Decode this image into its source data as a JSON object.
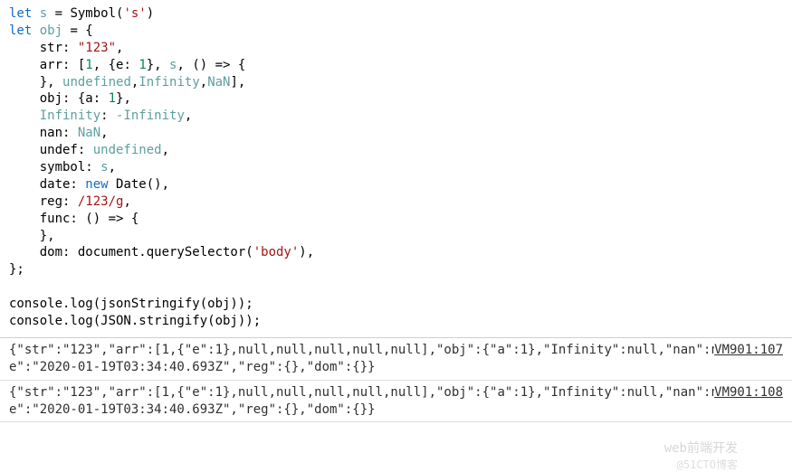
{
  "code": {
    "line0_let": "let ",
    "line0_s": "s",
    "line0_eq": " = Symbol(",
    "line0_str": "'s'",
    "line0_end": ")",
    "line1_let": "let ",
    "line1_obj": "obj",
    "line1_eq": " = {",
    "line2_prop": "    str: ",
    "line2_val": "\"123\"",
    "line2_end": ",",
    "line3_prop": "    arr: [",
    "line3_n1": "1",
    "line3_mid1": ", {e: ",
    "line3_n2": "1",
    "line3_mid2": "}, ",
    "line3_s": "s",
    "line3_mid3": ", () => {",
    "line4_close": "    }, ",
    "line4_undef": "undefined",
    "line4_sep1": ",",
    "line4_inf": "Infinity",
    "line4_sep2": ",",
    "line4_nan": "NaN",
    "line4_end": "],",
    "line5_prop": "    obj: {a: ",
    "line5_n": "1",
    "line5_end": "},",
    "line6_prop": "    ",
    "line6_inf": "Infinity",
    "line6_mid": ": ",
    "line6_neg": "-Infinity",
    "line6_end": ",",
    "line7_prop": "    nan: ",
    "line7_nan": "NaN",
    "line7_end": ",",
    "line8_prop": "    undef: ",
    "line8_undef": "undefined",
    "line8_end": ",",
    "line9_prop": "    symbol: ",
    "line9_s": "s",
    "line9_end": ",",
    "line10_prop": "    date: ",
    "line10_new": "new",
    "line10_date": " Date(),",
    "line11_prop": "    reg: ",
    "line11_reg": "/123/g",
    "line11_end": ",",
    "line12_prop": "    func: () => {",
    "line13_close": "    },",
    "line14_prop": "    dom: document.querySelector(",
    "line14_body": "'body'",
    "line14_end": "),",
    "line15_close": "};",
    "line16_blank": "",
    "line17": "console.log(jsonStringify(obj));",
    "line18": "console.log(JSON.stringify(obj));"
  },
  "console": [
    {
      "text": "{\"str\":\"123\",\"arr\":[1,{\"e\":1},null,null,null,null,null],\"obj\":{\"a\":1},\"Infinity\":null,\"nan\":null,\"date\":\"2020-01-19T03:34:40.693Z\",\"reg\":{},\"dom\":{}}",
      "source": "VM901:107"
    },
    {
      "text": "{\"str\":\"123\",\"arr\":[1,{\"e\":1},null,null,null,null,null],\"obj\":{\"a\":1},\"Infinity\":null,\"nan\":null,\"date\":\"2020-01-19T03:34:40.693Z\",\"reg\":{},\"dom\":{}}",
      "source": "VM901:108"
    }
  ],
  "watermark": {
    "main": "web前端开发",
    "sub": "@51CTO博客"
  }
}
